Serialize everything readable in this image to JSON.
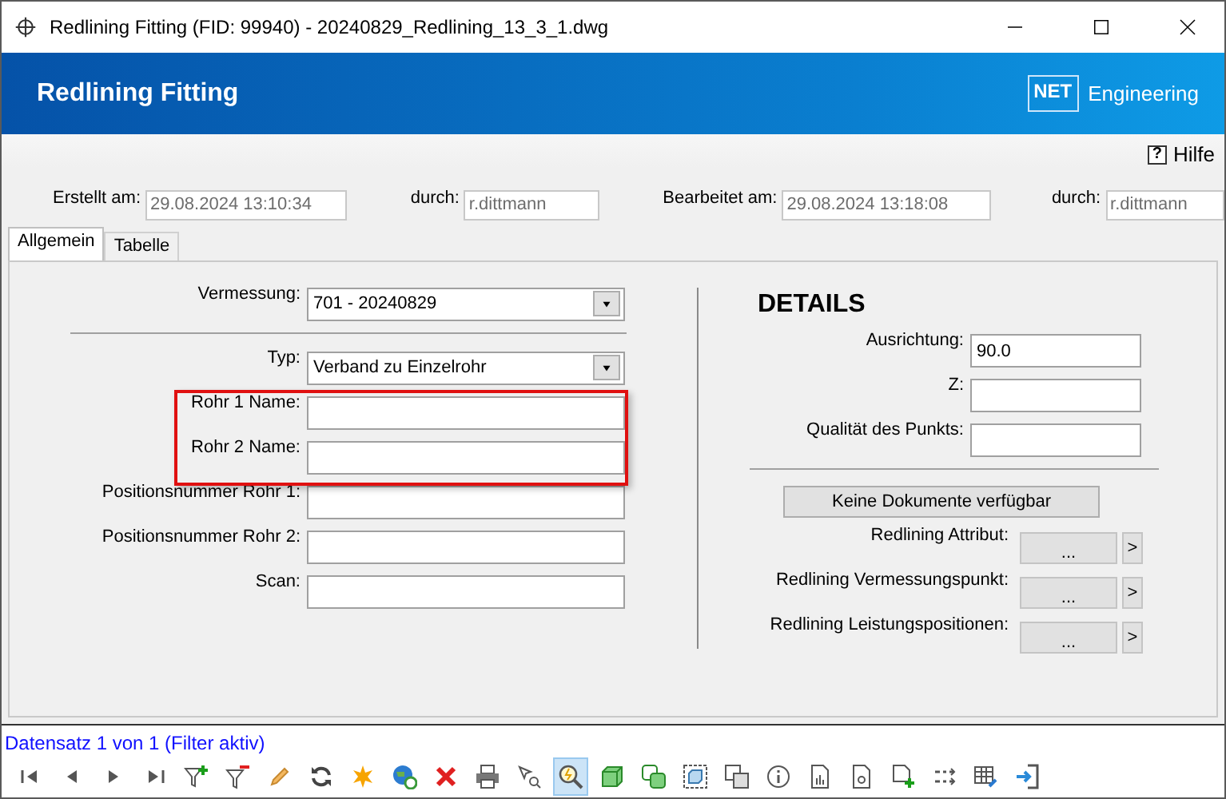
{
  "window": {
    "title": "Redlining Fitting (FID: 99940) - 20240829_Redlining_13_3_1.dwg"
  },
  "header": {
    "title": "Redlining Fitting",
    "logo_box": "NET",
    "logo_text": "Engineering"
  },
  "help": {
    "icon": "?",
    "label": "Hilfe"
  },
  "meta": [
    {
      "label": "Erstellt am:",
      "value": "29.08.2024 13:10:34"
    },
    {
      "label": "durch:",
      "value": "r.dittmann"
    },
    {
      "label": "Bearbeitet am:",
      "value": "29.08.2024 13:18:08"
    },
    {
      "label": "durch:",
      "value": "r.dittmann"
    }
  ],
  "tabs": [
    {
      "label": "Allgemein",
      "selected": true
    },
    {
      "label": "Tabelle",
      "selected": false
    }
  ],
  "left_fields": [
    {
      "kind": "combo",
      "label": "Vermessung:",
      "value": "701 - 20240829"
    },
    {
      "kind": "separator"
    },
    {
      "kind": "combo",
      "label": "Typ:",
      "value": "Verband zu Einzelrohr"
    },
    {
      "kind": "text",
      "label": "Rohr 1 Name:",
      "highlighted": true
    },
    {
      "kind": "text",
      "label": "Rohr 2 Name:",
      "highlighted": true
    },
    {
      "kind": "text",
      "label": "Positionsnummer Rohr 1:"
    },
    {
      "kind": "text",
      "label": "Positionsnummer Rohr 2:"
    },
    {
      "kind": "text",
      "label": "Scan:"
    }
  ],
  "details": {
    "title": "DETAILS",
    "fields": [
      {
        "label": "Ausrichtung:",
        "value": "90.0"
      },
      {
        "label": "Z:"
      },
      {
        "label": "Qualität des Punkts:"
      }
    ],
    "documents_button": "Keine Dokumente verfügbar",
    "links": [
      {
        "label": "Redlining Attribut:",
        "button": "...",
        "arrow": ">"
      },
      {
        "label": "Redlining Vermessungspunkt:",
        "button": "...",
        "arrow": ">"
      },
      {
        "label": "Redlining Leistungspositionen:",
        "button": "...",
        "arrow": ">"
      }
    ]
  },
  "status": "Datensatz 1 von 1 (Filter aktiv)",
  "toolbar": [
    {
      "selected": false
    },
    {
      "selected": false
    },
    {
      "selected": false
    },
    {
      "selected": false
    },
    {
      "selected": false
    },
    {
      "selected": false
    },
    {
      "selected": false
    },
    {
      "selected": false
    },
    {
      "selected": false
    },
    {
      "selected": false
    },
    {
      "selected": false
    },
    {
      "selected": false
    },
    {
      "selected": false
    },
    {
      "selected": true
    },
    {
      "selected": false
    },
    {
      "selected": false
    },
    {
      "selected": false
    },
    {
      "selected": false
    },
    {
      "selected": false
    },
    {
      "selected": false
    },
    {
      "selected": false
    },
    {
      "selected": false
    },
    {
      "selected": false
    },
    {
      "selected": false
    },
    {
      "selected": false
    }
  ]
}
